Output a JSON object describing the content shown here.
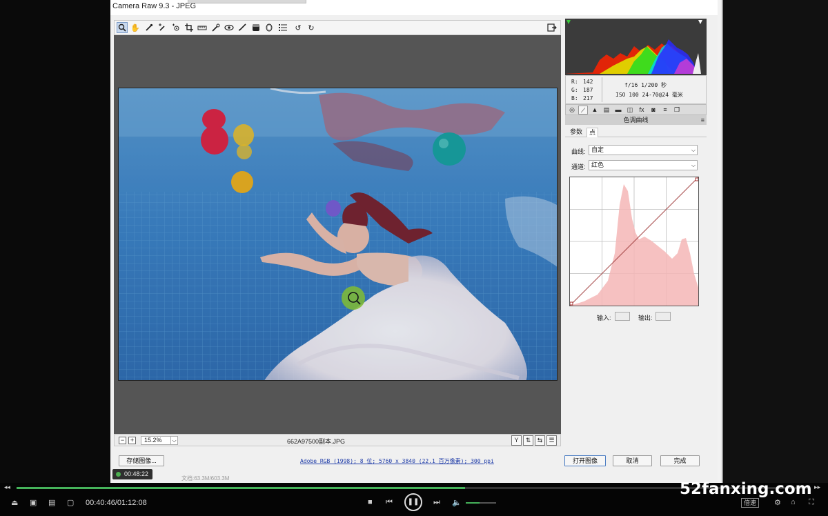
{
  "window": {
    "title": "Camera Raw 9.3 -  JPEG"
  },
  "toolbar": {
    "tools": [
      "zoom-icon",
      "hand-icon",
      "eyedropper-icon",
      "color-sampler-icon",
      "target-adjust-icon",
      "crop-icon",
      "straighten-icon",
      "spot-removal-icon",
      "red-eye-icon",
      "adjustment-brush-icon",
      "graduated-filter-icon",
      "radial-filter-icon",
      "preferences-icon",
      "rotate-left-icon",
      "rotate-right-icon"
    ],
    "fullscreen_icon": "fullscreen-icon"
  },
  "statusbar": {
    "zoom": "15.2%",
    "filename": "662A97500副本.JPG"
  },
  "info": {
    "r_label": "R:",
    "r_val": "142",
    "g_label": "G:",
    "g_val": "187",
    "b_label": "B:",
    "b_val": "217",
    "aperture_shutter": "f/16  1/200 秒",
    "iso_lens": "ISO 100  24-70@24 毫米"
  },
  "panel": {
    "title": "色调曲线",
    "subtabs": [
      "参数",
      "点"
    ],
    "active_subtab": 1,
    "curve_label": "曲线:",
    "curve_value": "自定",
    "channel_label": "通道:",
    "channel_value": "红色",
    "input_label": "输入:",
    "output_label": "输出:"
  },
  "bottom": {
    "save_label": "存储图像...",
    "colorspace": "Adobe RGB (1998); 8 位; 5760 x 3840 (22.1 百万像素); 300 ppi",
    "open_label": "打开图像",
    "cancel_label": "取消",
    "done_label": "完成"
  },
  "overlay": {
    "timer": "00:48:22",
    "doc_info": "文档:63.3M/603.3M"
  },
  "player": {
    "time": "00:40:46/01:12:08",
    "progress_fraction": 0.565,
    "volume_fraction": 0.45,
    "speed_label": "倍速",
    "watermark": "52fanxing.com"
  },
  "colors": {
    "accent_green": "#45b35a",
    "link_blue": "#1f3ca8"
  }
}
